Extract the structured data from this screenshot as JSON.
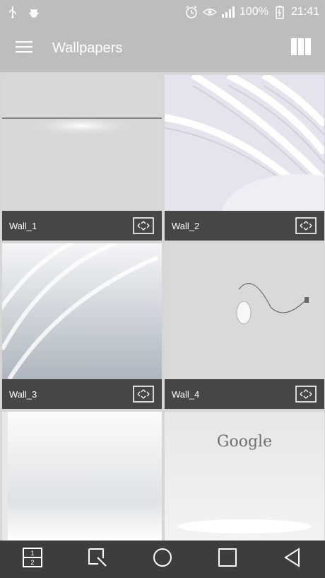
{
  "status": {
    "battery": "100%",
    "time": "21:41"
  },
  "app_bar": {
    "title": "Wallpapers"
  },
  "wallpapers": [
    {
      "label": "Wall_1"
    },
    {
      "label": "Wall_2"
    },
    {
      "label": "Wall_3"
    },
    {
      "label": "Wall_4"
    },
    {
      "label": ""
    },
    {
      "label": ""
    }
  ],
  "wall6_logo": "Google",
  "icons": {
    "menu": "hamburger-menu-icon",
    "layout": "grid-layout-icon",
    "fullscreen": "fullscreen-icon",
    "nav": [
      "dual-window-icon",
      "capture-icon",
      "home-icon",
      "recents-icon",
      "back-icon"
    ]
  },
  "colors": {
    "app_bar": "#bdbdbd",
    "caption": "#464646",
    "nav_bar": "#3d3d3d"
  }
}
